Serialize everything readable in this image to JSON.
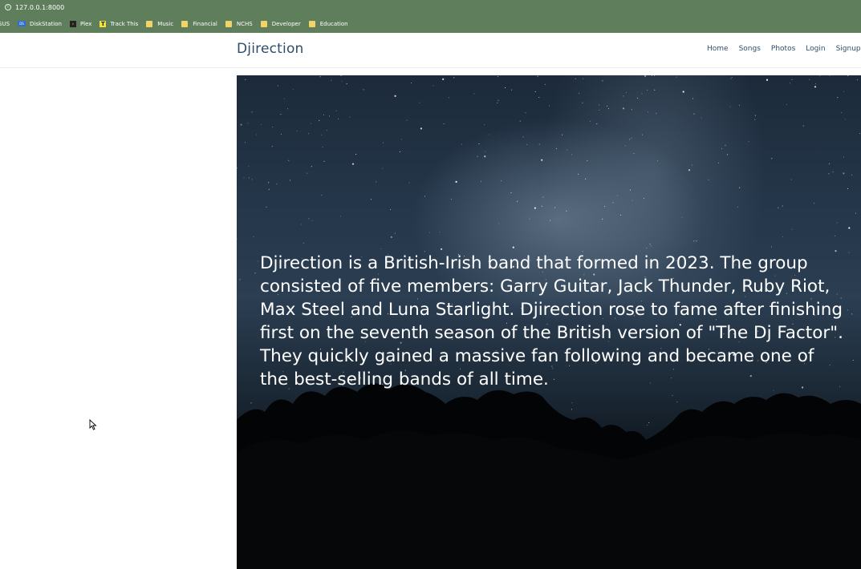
{
  "browser": {
    "url": "127.0.0.1:8000",
    "bookmarks": [
      {
        "label": "SUS",
        "icon": "folder-icon"
      },
      {
        "label": "DiskStation",
        "icon": "diskstation-icon"
      },
      {
        "label": "Plex",
        "icon": "plex-icon"
      },
      {
        "label": "Track This",
        "icon": "track-this-icon"
      },
      {
        "label": "Music",
        "icon": "folder-icon"
      },
      {
        "label": "Financial",
        "icon": "folder-icon"
      },
      {
        "label": "NCHS",
        "icon": "folder-icon"
      },
      {
        "label": "Developer",
        "icon": "folder-icon"
      },
      {
        "label": "Education",
        "icon": "folder-icon"
      }
    ]
  },
  "header": {
    "brand": "Djirection",
    "nav": [
      "Home",
      "Songs",
      "Photos",
      "Login",
      "Signup"
    ]
  },
  "hero": {
    "text": "Djirection is a British-Irish band that formed in 2023. The group consisted of five members: Garry Guitar, Jack Thunder, Ruby Riot, Max Steel and Luna Starlight. Djirection rose to fame after finishing first on the seventh season of the British version of \"The Dj Factor\". They quickly gained a massive fan following and became one of the best-selling bands of all time."
  },
  "colors": {
    "browser_chrome": "#5f7f5c",
    "brand_text": "#2e4d6b",
    "hero_text": "#ffffff"
  }
}
